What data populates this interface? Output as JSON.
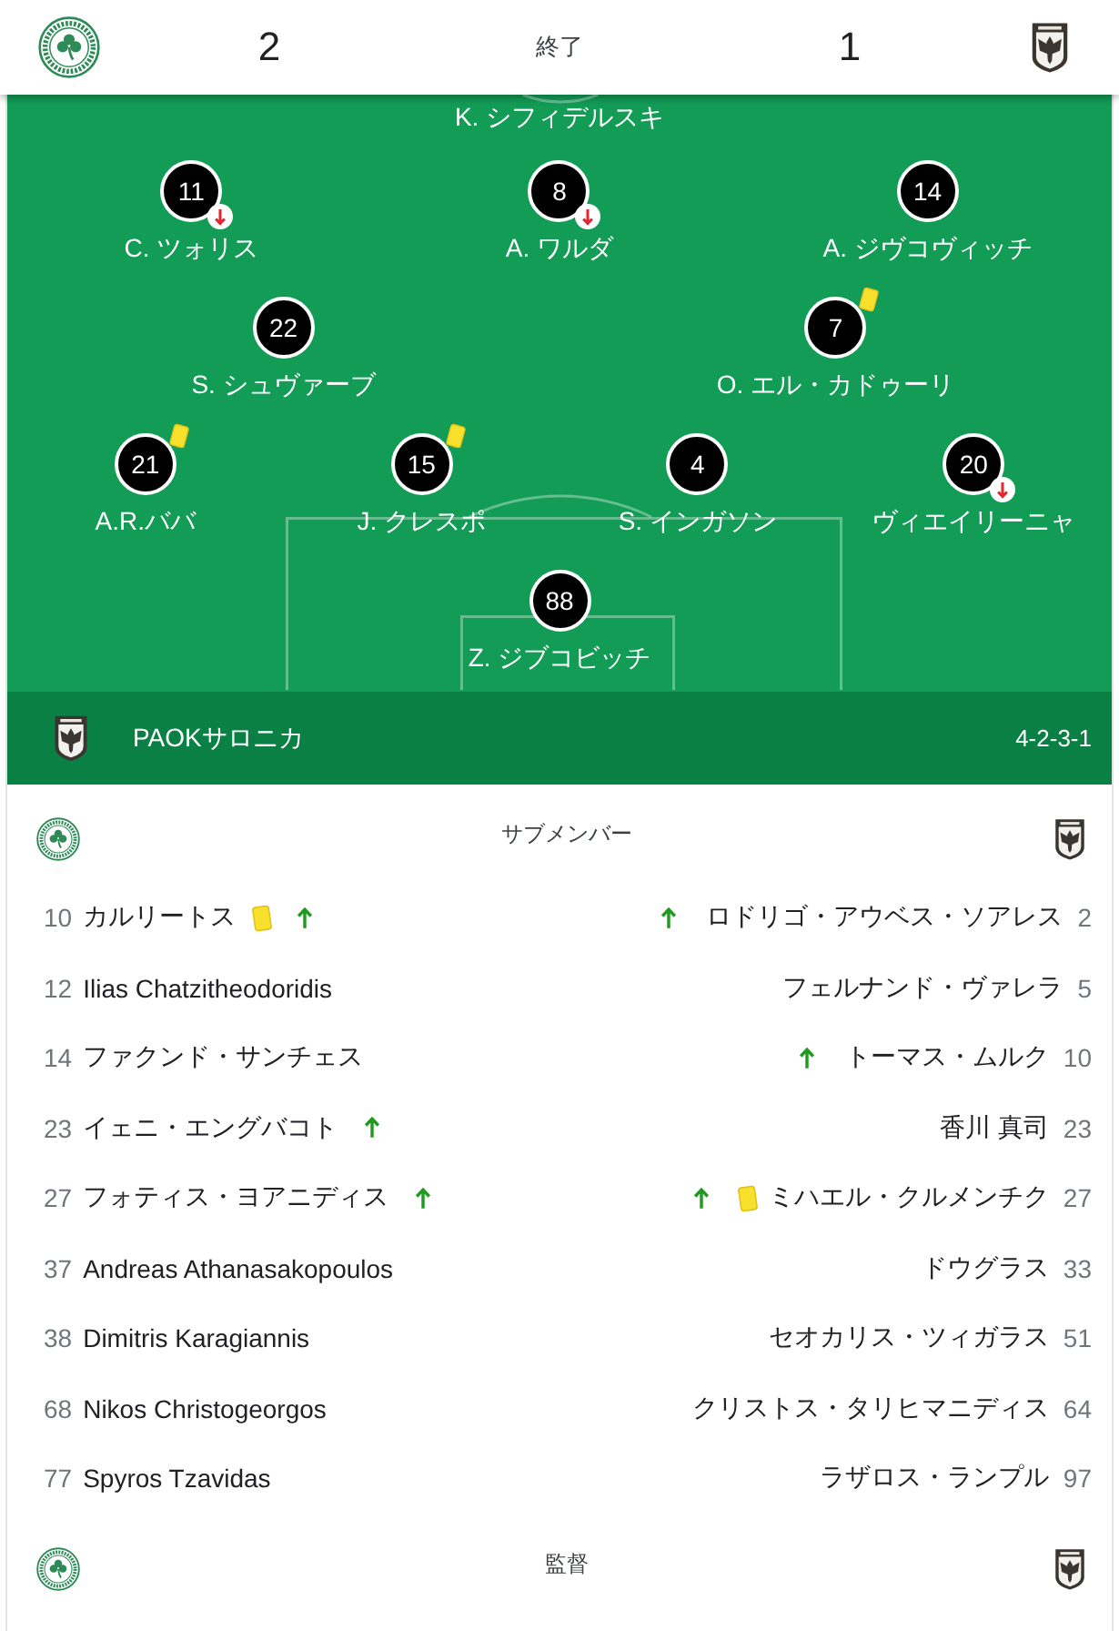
{
  "scoreboard": {
    "home_score": "2",
    "status": "終了",
    "away_score": "1"
  },
  "pitch": {
    "partial_name": "K. シフィデルスキ",
    "rows": [
      {
        "players": [
          {
            "number": "11",
            "name": "C. ツォリス",
            "yellow_card": false,
            "subbed_off": true
          },
          {
            "number": "8",
            "name": "A. ワルダ",
            "yellow_card": false,
            "subbed_off": true
          },
          {
            "number": "14",
            "name": "A. ジヴコヴィッチ",
            "yellow_card": false,
            "subbed_off": false
          }
        ]
      },
      {
        "players": [
          {
            "number": "22",
            "name": "S. シュヴァーブ",
            "yellow_card": false,
            "subbed_off": false
          },
          {
            "number": "7",
            "name": "O. エル・カドゥーリ",
            "yellow_card": true,
            "subbed_off": false
          }
        ]
      },
      {
        "players": [
          {
            "number": "21",
            "name": "A.R.ババ",
            "yellow_card": true,
            "subbed_off": false
          },
          {
            "number": "15",
            "name": "J. クレスポ",
            "yellow_card": true,
            "subbed_off": false
          },
          {
            "number": "4",
            "name": "S. インガソン",
            "yellow_card": false,
            "subbed_off": false
          },
          {
            "number": "20",
            "name": "ヴィエイリーニャ",
            "yellow_card": false,
            "subbed_off": true
          }
        ]
      },
      {
        "players": [
          {
            "number": "88",
            "name": "Z. ジブコビッチ",
            "yellow_card": false,
            "subbed_off": false
          }
        ]
      }
    ]
  },
  "team_bar": {
    "name": "PAOKサロニカ",
    "formation": "4-2-3-1"
  },
  "substitutes": {
    "title": "サブメンバー",
    "home": [
      {
        "number": "10",
        "name": "カルリートス",
        "yellow_card": true,
        "subbed_on": true
      },
      {
        "number": "12",
        "name": "Ilias Chatzitheodoridis",
        "yellow_card": false,
        "subbed_on": false
      },
      {
        "number": "14",
        "name": "ファクンド・サンチェス",
        "yellow_card": false,
        "subbed_on": false
      },
      {
        "number": "23",
        "name": "イェニ・エングバコト",
        "yellow_card": false,
        "subbed_on": true
      },
      {
        "number": "27",
        "name": "フォティス・ヨアニディス",
        "yellow_card": false,
        "subbed_on": true
      },
      {
        "number": "37",
        "name": "Andreas Athanasakopoulos",
        "yellow_card": false,
        "subbed_on": false
      },
      {
        "number": "38",
        "name": "Dimitris Karagiannis",
        "yellow_card": false,
        "subbed_on": false
      },
      {
        "number": "68",
        "name": "Nikos Christogeorgos",
        "yellow_card": false,
        "subbed_on": false
      },
      {
        "number": "77",
        "name": "Spyros Tzavidas",
        "yellow_card": false,
        "subbed_on": false
      }
    ],
    "away": [
      {
        "number": "2",
        "name": "ロドリゴ・アウベス・ソアレス",
        "yellow_card": false,
        "subbed_on": true
      },
      {
        "number": "5",
        "name": "フェルナンド・ヴァレラ",
        "yellow_card": false,
        "subbed_on": false
      },
      {
        "number": "10",
        "name": "トーマス・ムルク",
        "yellow_card": false,
        "subbed_on": true
      },
      {
        "number": "23",
        "name": "香川 真司",
        "yellow_card": false,
        "subbed_on": false
      },
      {
        "number": "27",
        "name": "ミハエル・クルメンチク",
        "yellow_card": true,
        "subbed_on": true
      },
      {
        "number": "33",
        "name": "ドウグラス",
        "yellow_card": false,
        "subbed_on": false
      },
      {
        "number": "51",
        "name": "セオカリス・ツィガラス",
        "yellow_card": false,
        "subbed_on": false
      },
      {
        "number": "64",
        "name": "クリストス・タリヒマニディス",
        "yellow_card": false,
        "subbed_on": false
      },
      {
        "number": "97",
        "name": "ラザロス・ランプル",
        "yellow_card": false,
        "subbed_on": false
      }
    ]
  },
  "managers": {
    "title": "監督"
  }
}
